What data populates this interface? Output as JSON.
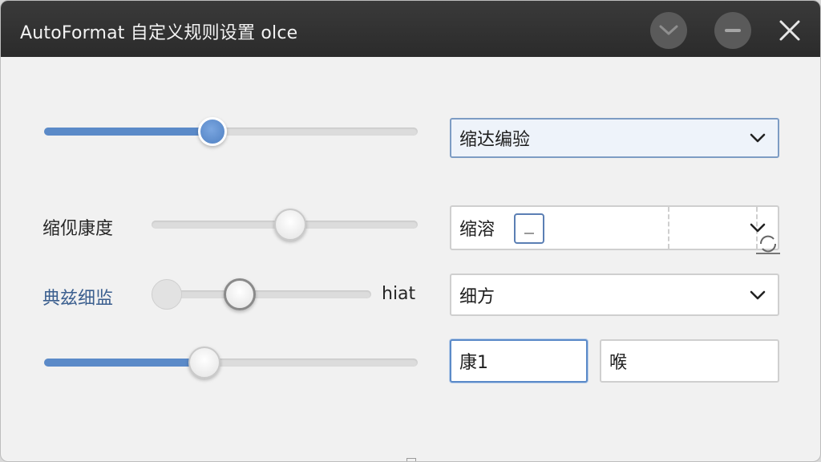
{
  "window": {
    "title": "AutoFormat 自定义规则设置 olce"
  },
  "titlebar_buttons": {
    "collapse_icon": "chevron-down-icon",
    "minimize_icon": "minimize-icon",
    "close_icon": "close-icon"
  },
  "rows": [
    {
      "slider_value": 0.45,
      "select_value": "缩达编验"
    },
    {
      "label": "缩伣康度",
      "slider_value": 0.52,
      "select_value": "缩溶"
    },
    {
      "label": "典兹细监",
      "slider_value": 0.4,
      "slider_suffix": "hiat",
      "select_value": "细方"
    },
    {
      "slider_value": 0.43,
      "input_primary": "康1",
      "input_secondary": "喉"
    }
  ],
  "colors": {
    "accent": "#5b8ac8",
    "titlebar": "#2f2f2f",
    "window_bg": "#f1f1f1"
  }
}
